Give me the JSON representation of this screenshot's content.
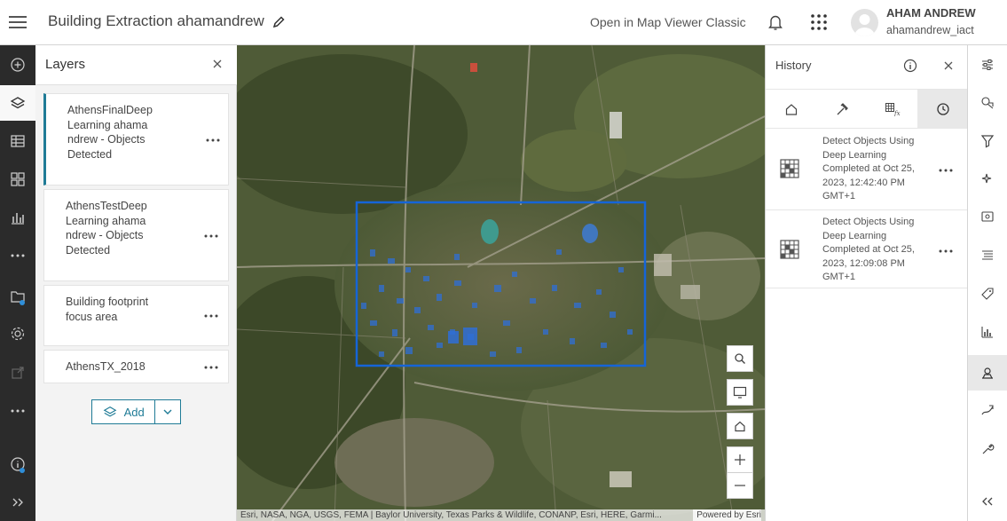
{
  "header": {
    "title": "Building Extraction ahamandrew",
    "open_classic": "Open in Map Viewer Classic",
    "user_name": "AHAM ANDREW",
    "user_id": "ahamandrew_iact"
  },
  "layers_panel": {
    "title": "Layers",
    "layers": [
      {
        "name": "AthensFinalDeepLearning ahamandrew - ObjectsDetected"
      },
      {
        "name": "AthensTestDeepLearning ahamandrew - ObjectsDetected"
      },
      {
        "name": "Building footprint focus area"
      },
      {
        "name": "AthensTX_2018"
      }
    ],
    "add_label": "Add"
  },
  "map": {
    "attribution": "Esri, NASA, NGA, USGS, FEMA | Baylor University, Texas Parks & Wildlife, CONANP, Esri, HERE, Garmi...",
    "powered_by": "Powered by Esri",
    "controls": [
      "search-icon",
      "monitor-icon",
      "home-icon",
      "zoom-in-icon",
      "zoom-out-icon"
    ]
  },
  "history": {
    "title": "History",
    "items": [
      {
        "line1": "Detect Objects Using",
        "line2": "Deep Learning",
        "line3": "Completed at Oct 25,",
        "line4": "2023, 12:42:40 PM",
        "line5": "GMT+1"
      },
      {
        "line1": "Detect Objects Using",
        "line2": "Deep Learning",
        "line3": "Completed at Oct 25,",
        "line4": "2023, 12:09:08 PM",
        "line5": "GMT+1"
      }
    ]
  },
  "colors": {
    "accent": "#1f7b96",
    "leftbar_bg": "#2b2b2b",
    "selection_blue": "#1565d8",
    "notification_dot": "#2f8ed8"
  }
}
